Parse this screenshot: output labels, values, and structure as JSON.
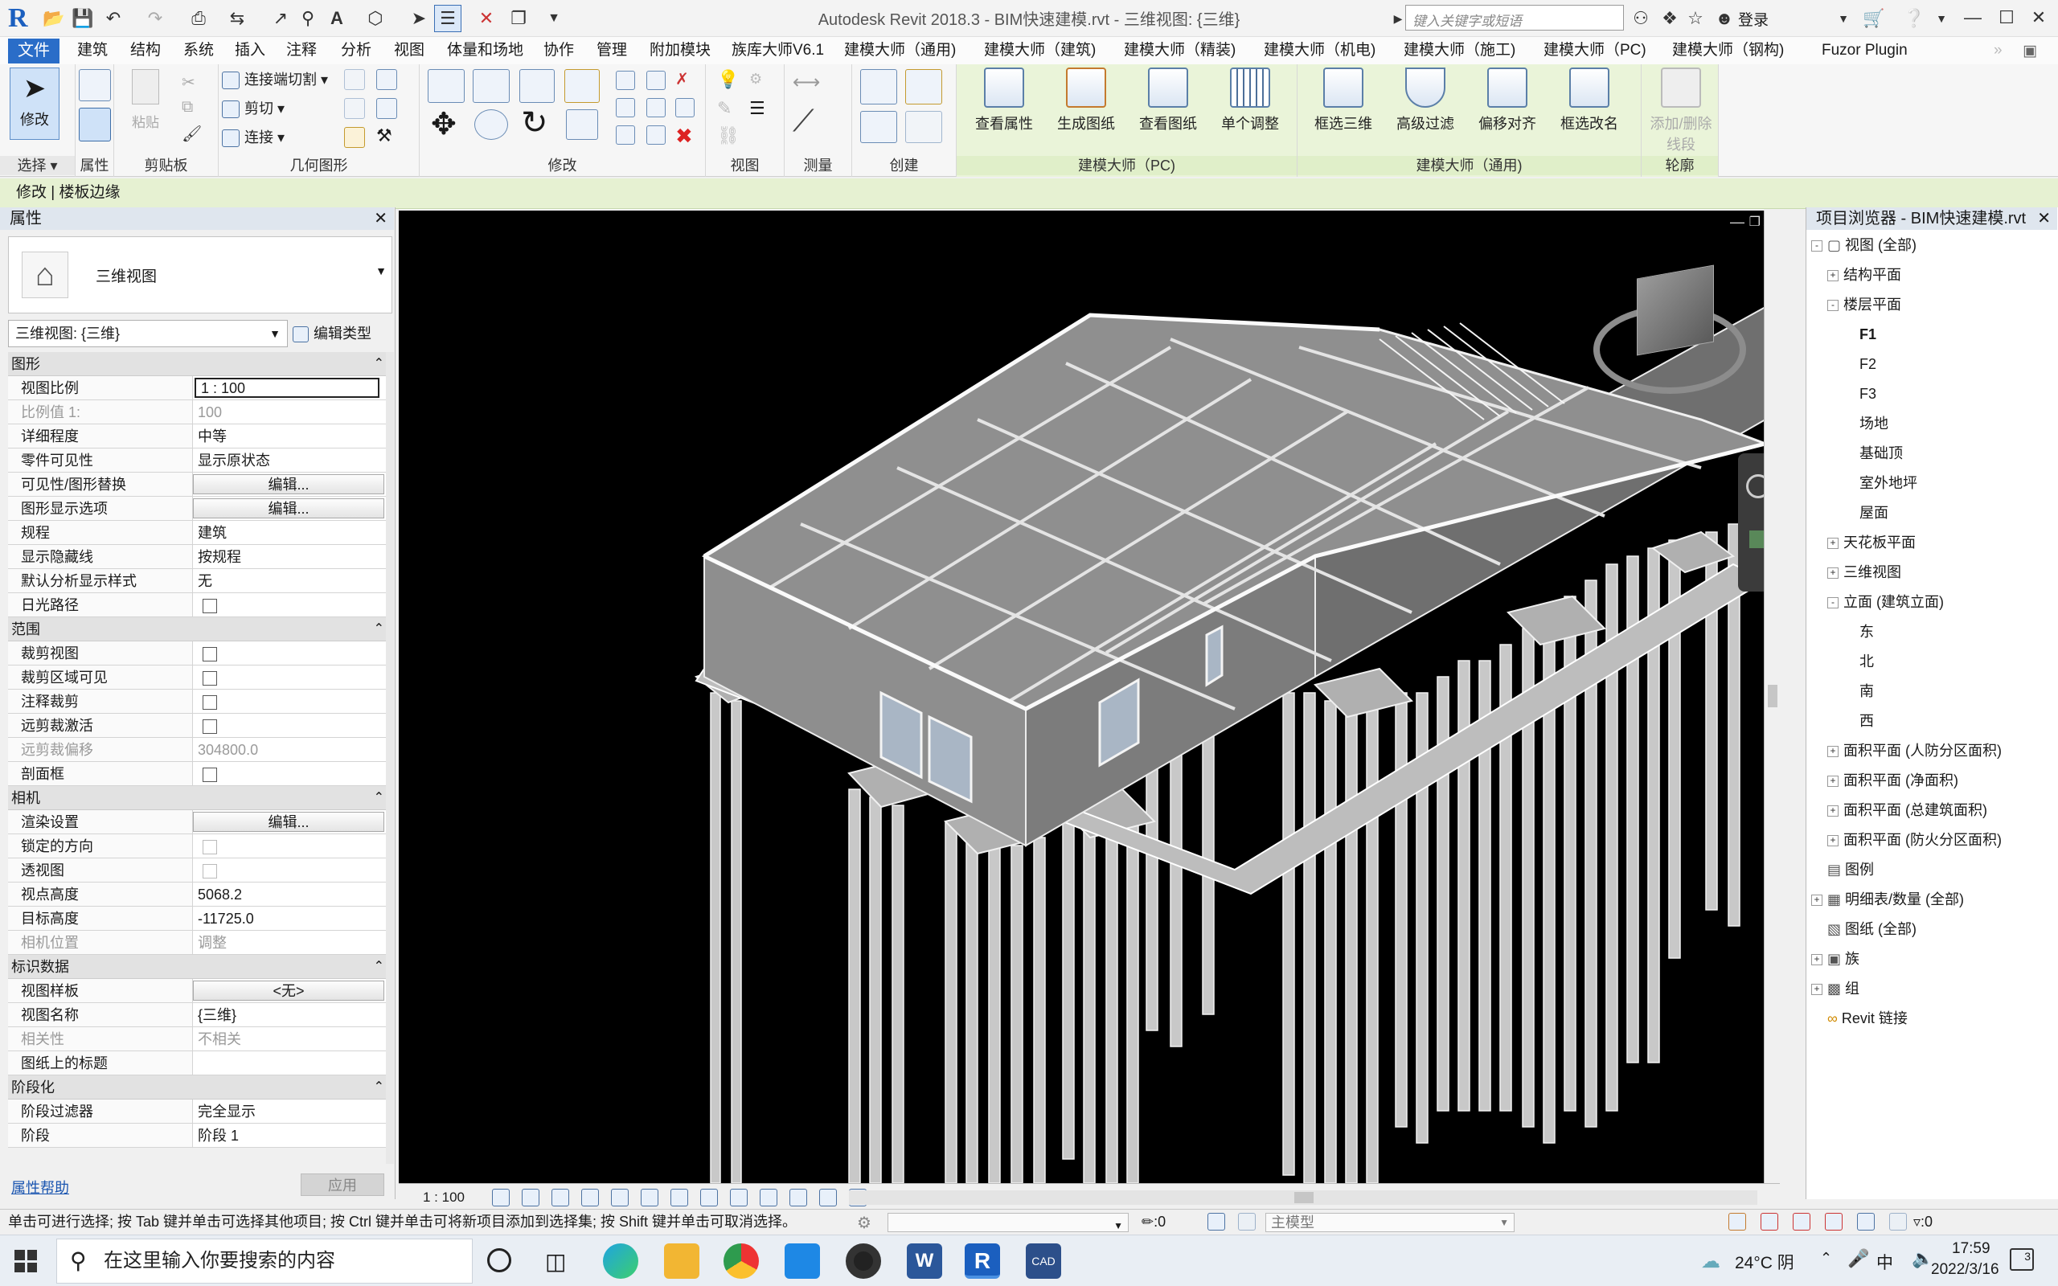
{
  "app": {
    "title": "Autodesk Revit 2018.3 -    BIM快速建模.rvt - 三维视图: {三维}",
    "search_placeholder": "键入关键字或短语",
    "login": "登录"
  },
  "tabs": [
    "文件",
    "建筑",
    "结构",
    "系统",
    "插入",
    "注释",
    "分析",
    "视图",
    "体量和场地",
    "协作",
    "管理",
    "附加模块",
    "族库大师V6.1",
    "建模大师（通用)",
    "建模大师（建筑)",
    "建模大师（精装)",
    "建模大师（机电)",
    "建模大师（施工)",
    "建模大师（PC)",
    "建模大师（钢构)",
    "Fuzor Plugin"
  ],
  "ribbon": {
    "modify": "修改",
    "select": "选择",
    "properties": "属性",
    "clipboard": "剪贴板",
    "paste": "粘贴",
    "geometry": "几何图形",
    "join_cut": "连接端切割",
    "cut": "剪切",
    "join": "连接",
    "modify_panel": "修改",
    "view_panel": "视图",
    "measure_panel": "测量",
    "create_panel": "创建",
    "pc_buttons": [
      "查看属性",
      "生成图纸",
      "查看图纸",
      "单个调整"
    ],
    "pc_panel": "建模大师（PC)",
    "general_buttons": [
      "框选三维",
      "高级过滤",
      "偏移对齐",
      "框选改名"
    ],
    "general_panel": "建模大师（通用)",
    "outline_button_1": "添加/删除",
    "outline_button_2": "线段",
    "outline_panel": "轮廓"
  },
  "context": "修改 | 楼板边缘",
  "properties": {
    "title": "属性",
    "type_name": "三维视图",
    "type_selector": "三维视图: {三维}",
    "edit_type": "编辑类型",
    "groups": [
      {
        "name": "图形",
        "rows": [
          {
            "k": "视图比例",
            "v": "1 : 100",
            "kind": "input"
          },
          {
            "k": "比例值 1:",
            "v": "100",
            "kind": "dim"
          },
          {
            "k": "详细程度",
            "v": "中等"
          },
          {
            "k": "零件可见性",
            "v": "显示原状态"
          },
          {
            "k": "可见性/图形替换",
            "v": "编辑...",
            "kind": "btn"
          },
          {
            "k": "图形显示选项",
            "v": "编辑...",
            "kind": "btn"
          },
          {
            "k": "规程",
            "v": "建筑"
          },
          {
            "k": "显示隐藏线",
            "v": "按规程"
          },
          {
            "k": "默认分析显示样式",
            "v": "无"
          },
          {
            "k": "日光路径",
            "v": "",
            "kind": "cb"
          }
        ]
      },
      {
        "name": "范围",
        "rows": [
          {
            "k": "裁剪视图",
            "v": "",
            "kind": "cb"
          },
          {
            "k": "裁剪区域可见",
            "v": "",
            "kind": "cb"
          },
          {
            "k": "注释裁剪",
            "v": "",
            "kind": "cb"
          },
          {
            "k": "远剪裁激活",
            "v": "",
            "kind": "cb"
          },
          {
            "k": "远剪裁偏移",
            "v": "304800.0",
            "kind": "dim"
          },
          {
            "k": "剖面框",
            "v": "",
            "kind": "cb"
          }
        ]
      },
      {
        "name": "相机",
        "rows": [
          {
            "k": "渲染设置",
            "v": "编辑...",
            "kind": "btn"
          },
          {
            "k": "锁定的方向",
            "v": "",
            "kind": "cbdim"
          },
          {
            "k": "透视图",
            "v": "",
            "kind": "cbdim"
          },
          {
            "k": "视点高度",
            "v": "5068.2"
          },
          {
            "k": "目标高度",
            "v": "-11725.0"
          },
          {
            "k": "相机位置",
            "v": "调整",
            "kind": "dim"
          }
        ]
      },
      {
        "name": "标识数据",
        "rows": [
          {
            "k": "视图样板",
            "v": "<无>",
            "kind": "btn"
          },
          {
            "k": "视图名称",
            "v": "{三维}"
          },
          {
            "k": "相关性",
            "v": "不相关",
            "kind": "dim"
          },
          {
            "k": "图纸上的标题",
            "v": ""
          }
        ]
      },
      {
        "name": "阶段化",
        "rows": [
          {
            "k": "阶段过滤器",
            "v": "完全显示"
          },
          {
            "k": "阶段",
            "v": "阶段 1"
          }
        ]
      }
    ],
    "help": "属性帮助",
    "apply": "应用"
  },
  "viewport": {
    "scale": "1 : 100"
  },
  "browser": {
    "title": "项目浏览器 - BIM快速建模.rvt",
    "nodes": [
      {
        "label": "视图 (全部)",
        "level": 0,
        "exp": "-"
      },
      {
        "label": "结构平面",
        "level": 1,
        "exp": "+"
      },
      {
        "label": "楼层平面",
        "level": 1,
        "exp": "-"
      },
      {
        "label": "F1",
        "level": 2,
        "exp": "",
        "bold": true
      },
      {
        "label": "F2",
        "level": 2,
        "exp": ""
      },
      {
        "label": "F3",
        "level": 2,
        "exp": ""
      },
      {
        "label": "场地",
        "level": 2,
        "exp": ""
      },
      {
        "label": "基础顶",
        "level": 2,
        "exp": ""
      },
      {
        "label": "室外地坪",
        "level": 2,
        "exp": ""
      },
      {
        "label": "屋面",
        "level": 2,
        "exp": ""
      },
      {
        "label": "天花板平面",
        "level": 1,
        "exp": "+"
      },
      {
        "label": "三维视图",
        "level": 1,
        "exp": "+"
      },
      {
        "label": "立面 (建筑立面)",
        "level": 1,
        "exp": "-"
      },
      {
        "label": "东",
        "level": 2,
        "exp": ""
      },
      {
        "label": "北",
        "level": 2,
        "exp": ""
      },
      {
        "label": "南",
        "level": 2,
        "exp": ""
      },
      {
        "label": "西",
        "level": 2,
        "exp": ""
      },
      {
        "label": "面积平面 (人防分区面积)",
        "level": 1,
        "exp": "+"
      },
      {
        "label": "面积平面 (净面积)",
        "level": 1,
        "exp": "+"
      },
      {
        "label": "面积平面 (总建筑面积)",
        "level": 1,
        "exp": "+"
      },
      {
        "label": "面积平面 (防火分区面积)",
        "level": 1,
        "exp": "+"
      },
      {
        "label": "图例",
        "level": 0,
        "exp": ""
      },
      {
        "label": "明细表/数量 (全部)",
        "level": 0,
        "exp": "+"
      },
      {
        "label": "图纸 (全部)",
        "level": 0,
        "exp": ""
      },
      {
        "label": "族",
        "level": 0,
        "exp": "+"
      },
      {
        "label": "组",
        "level": 0,
        "exp": "+"
      },
      {
        "label": "Revit 链接",
        "level": 0,
        "exp": ""
      }
    ]
  },
  "status": {
    "hint": "单击可进行选择; 按 Tab 键并单击可选择其他项目; 按 Ctrl 键并单击可将新项目添加到选择集; 按 Shift 键并单击可取消选择。",
    "workset_count": ":0",
    "model": "主模型",
    "filter_count": ":0"
  },
  "taskbar": {
    "search": "在这里输入你要搜索的内容",
    "weather": "24°C 阴",
    "ime": "中",
    "time": "17:59",
    "date": "2022/3/16",
    "notifications": "3"
  }
}
